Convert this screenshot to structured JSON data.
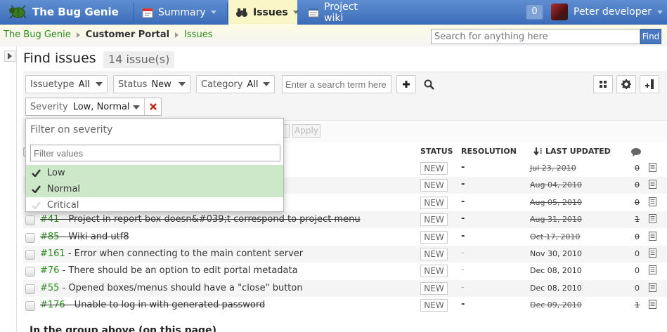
{
  "app": {
    "name": "The Bug Genie"
  },
  "nav": {
    "tabs": [
      {
        "label": "Summary",
        "icon": "calendar-icon"
      },
      {
        "label": "Issues",
        "icon": "binoculars-icon"
      },
      {
        "label": "Project wiki",
        "icon": "wiki-icon"
      }
    ],
    "notifications": "0",
    "user": "Peter developer"
  },
  "breadcrumb": [
    "The Bug Genie",
    "Customer Portal",
    "Issues"
  ],
  "search": {
    "placeholder": "Search for anything here",
    "button": "Find"
  },
  "page": {
    "title": "Find issues",
    "count": "14 issue(s)"
  },
  "filters": {
    "issuetype": {
      "label": "Issuetype",
      "value": "All"
    },
    "status": {
      "label": "Status",
      "value": "New"
    },
    "category": {
      "label": "Category",
      "value": "All"
    },
    "search_placeholder": "Enter a search term here",
    "severity": {
      "label": "Severity",
      "value": "Low, Normal"
    }
  },
  "bulk": {
    "apply": "Apply"
  },
  "dropdown": {
    "title": "Filter on severity",
    "filter_placeholder": "Filter values",
    "options": [
      {
        "label": "Low",
        "selected": true
      },
      {
        "label": "Normal",
        "selected": true
      },
      {
        "label": "Critical",
        "selected": false
      }
    ]
  },
  "table": {
    "headers": {
      "status": "STATUS",
      "resolution": "RESOLUTION",
      "last_updated": "LAST UPDATED"
    },
    "rows": [
      {
        "num": "",
        "title": "",
        "status": "NEW",
        "resolution": "-",
        "updated": "Jul 23, 2010",
        "comments": "0",
        "closed": true
      },
      {
        "num": "",
        "title": "",
        "status": "NEW",
        "resolution": "-",
        "updated": "Aug 04, 2010",
        "comments": "0",
        "closed": true
      },
      {
        "num": "",
        "title": "",
        "status": "NEW",
        "resolution": "-",
        "updated": "Aug 05, 2010",
        "comments": "0",
        "closed": true
      },
      {
        "num": "#41",
        "title": " - Project in report box doesn&#039;t correspond to project menu",
        "status": "NEW",
        "resolution": "-",
        "updated": "Aug 31, 2010",
        "comments": "1",
        "closed": true
      },
      {
        "num": "#85",
        "title": " - Wiki and utf8",
        "status": "NEW",
        "resolution": "-",
        "updated": "Oct 17, 2010",
        "comments": "0",
        "closed": true
      },
      {
        "num": "#161",
        "title": " - Error when connecting to the main content server",
        "status": "NEW",
        "resolution": "-",
        "updated": "Nov 30, 2010",
        "comments": "0",
        "closed": false
      },
      {
        "num": "#76",
        "title": " - There should be an option to edit portal metadata",
        "status": "NEW",
        "resolution": "-",
        "updated": "Dec 08, 2010",
        "comments": "0",
        "closed": false
      },
      {
        "num": "#55",
        "title": " - Opened boxes/menus should have a \"close\" button",
        "status": "NEW",
        "resolution": "-",
        "updated": "Dec 08, 2010",
        "comments": "0",
        "closed": false
      },
      {
        "num": "#176",
        "title": " - Unable to log in with generated password",
        "status": "NEW",
        "resolution": "-",
        "updated": "Dec 09, 2010",
        "comments": "1",
        "closed": true
      }
    ]
  },
  "footer": {
    "text": "In the group above (on this page)"
  }
}
